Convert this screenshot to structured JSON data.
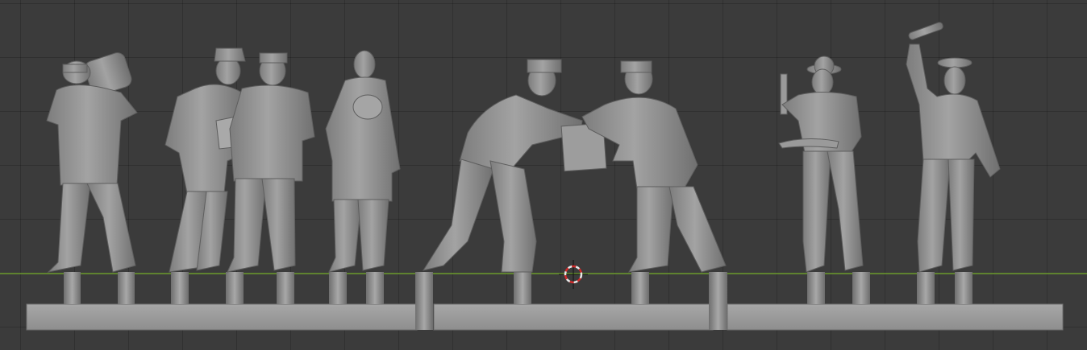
{
  "viewport": {
    "background_color": "#3b3b3b",
    "grid_color": "#2f2f2f",
    "x_axis_color": "#6e9e2e",
    "model_color": "#8f8f8f",
    "model_shadow_color": "#6a6a6a",
    "cursor_colors": [
      "#e8e8e8",
      "#d42a2a"
    ]
  },
  "scene": {
    "description_items": [
      "figure-barrel-carrier",
      "figure-map-reader-left",
      "figure-map-reader-right",
      "figure-long-coat",
      "figure-crate-giver",
      "figure-crate-receiver",
      "figure-rope-holder",
      "figure-raised-arm"
    ]
  }
}
